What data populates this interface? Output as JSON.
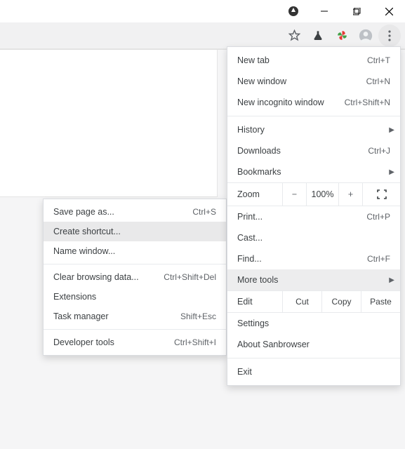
{
  "mainMenu": {
    "group1": [
      {
        "label": "New tab",
        "shortcut": "Ctrl+T"
      },
      {
        "label": "New window",
        "shortcut": "Ctrl+N"
      },
      {
        "label": "New incognito window",
        "shortcut": "Ctrl+Shift+N"
      }
    ],
    "group2": {
      "history": "History",
      "downloads": {
        "label": "Downloads",
        "shortcut": "Ctrl+J"
      },
      "bookmarks": "Bookmarks"
    },
    "zoom": {
      "label": "Zoom",
      "minus": "−",
      "value": "100%",
      "plus": "+"
    },
    "group3": {
      "print": {
        "label": "Print...",
        "shortcut": "Ctrl+P"
      },
      "cast": "Cast...",
      "find": {
        "label": "Find...",
        "shortcut": "Ctrl+F"
      },
      "moreTools": "More tools"
    },
    "edit": {
      "label": "Edit",
      "cut": "Cut",
      "copy": "Copy",
      "paste": "Paste"
    },
    "group4": {
      "settings": "Settings",
      "about": "About Sanbrowser"
    },
    "exit": "Exit"
  },
  "subMenu": {
    "group1": {
      "savePage": {
        "label": "Save page as...",
        "shortcut": "Ctrl+S"
      },
      "createShortcut": "Create shortcut...",
      "nameWindow": "Name window..."
    },
    "group2": {
      "clearData": {
        "label": "Clear browsing data...",
        "shortcut": "Ctrl+Shift+Del"
      },
      "extensions": "Extensions",
      "taskManager": {
        "label": "Task manager",
        "shortcut": "Shift+Esc"
      }
    },
    "group3": {
      "devTools": {
        "label": "Developer tools",
        "shortcut": "Ctrl+Shift+I"
      }
    }
  }
}
